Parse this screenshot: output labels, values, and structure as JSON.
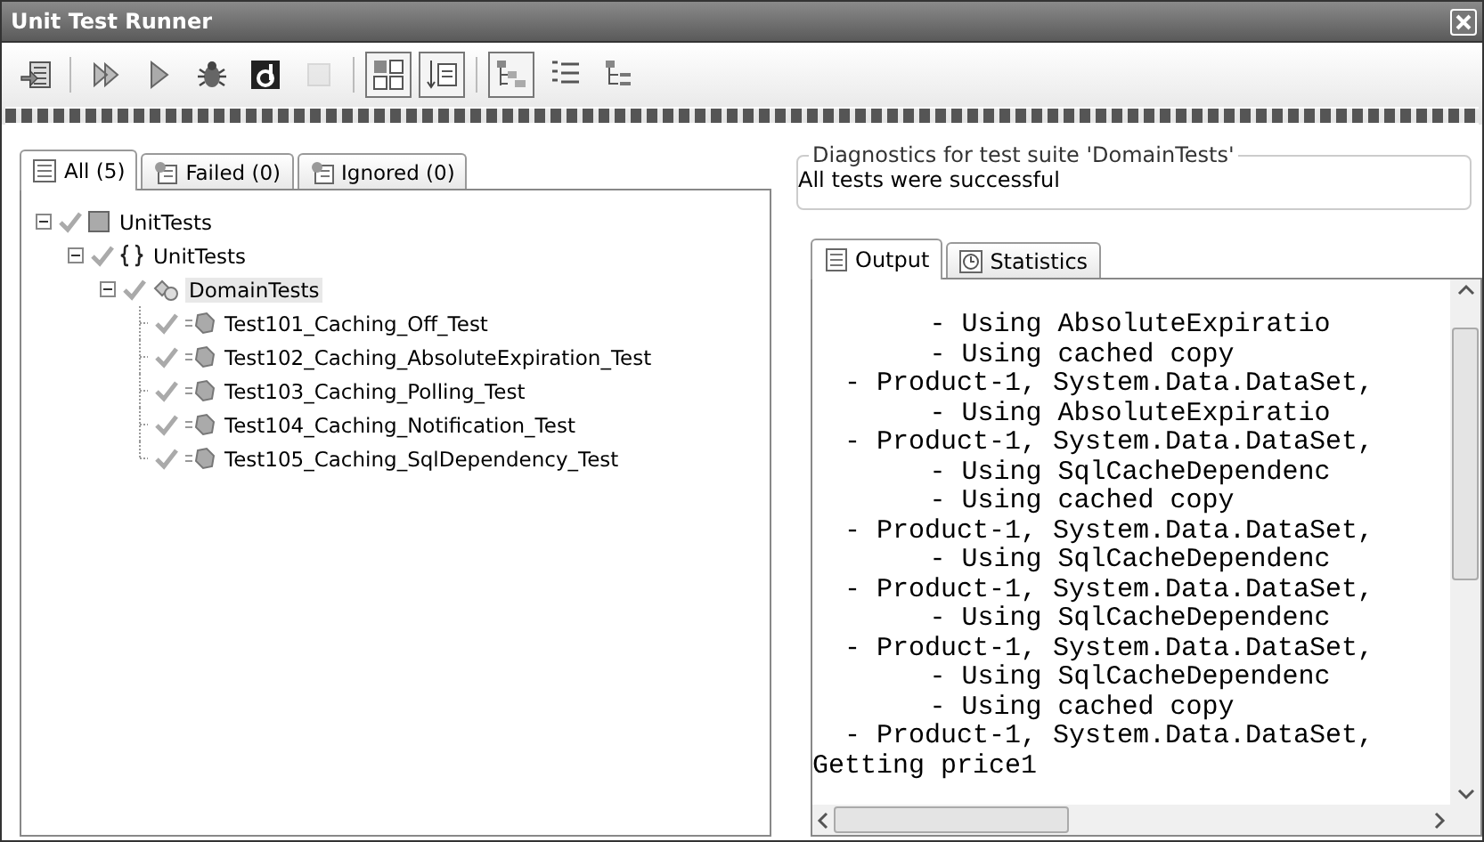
{
  "window": {
    "title": "Unit Test Runner"
  },
  "toolbar": [
    {
      "kind": "load",
      "pressed": false,
      "disabled": false
    },
    {
      "kind": "run-all",
      "pressed": false,
      "disabled": false
    },
    {
      "kind": "run",
      "pressed": false,
      "disabled": false
    },
    {
      "kind": "debug",
      "pressed": false,
      "disabled": false
    },
    {
      "kind": "profile",
      "pressed": false,
      "disabled": false
    },
    {
      "kind": "stop",
      "pressed": false,
      "disabled": true
    },
    {
      "kind": "grid",
      "pressed": true,
      "disabled": false
    },
    {
      "kind": "align",
      "pressed": true,
      "disabled": false
    },
    {
      "kind": "tree",
      "pressed": true,
      "disabled": false
    },
    {
      "kind": "list",
      "pressed": false,
      "disabled": false
    },
    {
      "kind": "flat",
      "pressed": false,
      "disabled": false
    }
  ],
  "test_tabs": [
    {
      "label": "All (5)",
      "selected": true
    },
    {
      "label": "Failed (0)",
      "selected": false
    },
    {
      "label": "Ignored (0)",
      "selected": false
    }
  ],
  "tree": [
    {
      "kind": "project",
      "label": "UnitTests",
      "passed": true,
      "expanded": true,
      "selected": false,
      "children": [
        {
          "kind": "namespace",
          "label": "UnitTests",
          "passed": true,
          "expanded": true,
          "selected": false,
          "children": [
            {
              "kind": "fixture",
              "label": "DomainTests",
              "passed": true,
              "expanded": true,
              "selected": true,
              "children": [
                {
                  "kind": "test",
                  "label": "Test101_Caching_Off_Test",
                  "passed": true,
                  "selected": false
                },
                {
                  "kind": "test",
                  "label": "Test102_Caching_AbsoluteExpiration_Test",
                  "passed": true,
                  "selected": false
                },
                {
                  "kind": "test",
                  "label": "Test103_Caching_Polling_Test",
                  "passed": true,
                  "selected": false
                },
                {
                  "kind": "test",
                  "label": "Test104_Caching_Notification_Test",
                  "passed": true,
                  "selected": false
                },
                {
                  "kind": "test",
                  "label": "Test105_Caching_SqlDependency_Test",
                  "passed": true,
                  "selected": false
                }
              ]
            }
          ]
        }
      ]
    }
  ],
  "diagnostics": {
    "legend": "Diagnostics for test suite 'DomainTests'",
    "message": "All tests were successful"
  },
  "output_tabs": [
    {
      "label": "Output",
      "selected": true
    },
    {
      "label": "Statistics",
      "selected": false
    }
  ],
  "output_lines": [
    {
      "kind": "detail",
      "text": "- Using AbsoluteExpiratio"
    },
    {
      "kind": "detail",
      "text": "- Using cached copy"
    },
    {
      "kind": "item",
      "text": "- Product-1, System.Data.DataSet,"
    },
    {
      "kind": "detail",
      "text": "- Using AbsoluteExpiratio"
    },
    {
      "kind": "item",
      "text": "- Product-1, System.Data.DataSet,"
    },
    {
      "kind": "detail",
      "text": "- Using SqlCacheDependenc"
    },
    {
      "kind": "detail",
      "text": "- Using cached copy"
    },
    {
      "kind": "item",
      "text": "- Product-1, System.Data.DataSet,"
    },
    {
      "kind": "detail",
      "text": "- Using SqlCacheDependenc"
    },
    {
      "kind": "item",
      "text": "- Product-1, System.Data.DataSet,"
    },
    {
      "kind": "detail",
      "text": "- Using SqlCacheDependenc"
    },
    {
      "kind": "item",
      "text": "- Product-1, System.Data.DataSet,"
    },
    {
      "kind": "detail",
      "text": "- Using SqlCacheDependenc"
    },
    {
      "kind": "detail",
      "text": "- Using cached copy"
    },
    {
      "kind": "item",
      "text": "- Product-1, System.Data.DataSet,"
    },
    {
      "kind": "plain",
      "text": "Getting price1"
    }
  ]
}
